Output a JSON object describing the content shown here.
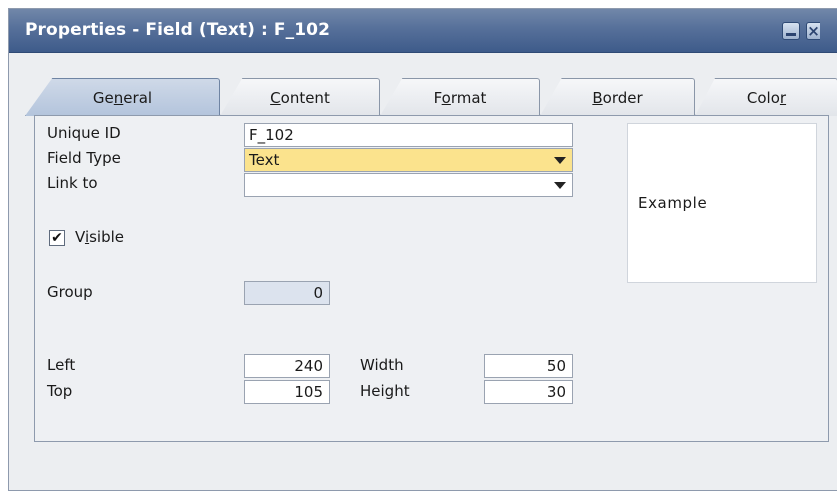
{
  "window": {
    "title": "Properties - Field (Text) : F_102"
  },
  "titlebar_buttons": {
    "close_glyph": "×"
  },
  "tabs": [
    {
      "pre": "Ge",
      "ul": "n",
      "post": "eral",
      "active": true
    },
    {
      "pre": "",
      "ul": "C",
      "post": "ontent",
      "active": false
    },
    {
      "pre": "F",
      "ul": "o",
      "post": "rmat",
      "active": false
    },
    {
      "pre": "",
      "ul": "B",
      "post": "order",
      "active": false
    },
    {
      "pre": "Colo",
      "ul": "r",
      "post": "",
      "active": false
    }
  ],
  "general": {
    "unique_id_label": "Unique ID",
    "unique_id_value": "F_102",
    "field_type_label": "Field Type",
    "field_type_value": "Text",
    "link_to_label": "Link to",
    "link_to_value": "",
    "visible_label_pre": "V",
    "visible_label_ul": "i",
    "visible_label_post": "sible",
    "visible_checked": true,
    "visible_check_glyph": "✔",
    "group_label": "Group",
    "group_value": "0",
    "left_label": "Left",
    "left_value": "240",
    "top_label": "Top",
    "top_value": "105",
    "width_label": "Width",
    "width_value": "50",
    "height_label": "Height",
    "height_value": "30"
  },
  "example": {
    "text": "Example"
  },
  "colors": {
    "title_bar": "#56709a",
    "field_type_highlight": "#fbe38d",
    "active_tab": "#b3c4dc"
  }
}
